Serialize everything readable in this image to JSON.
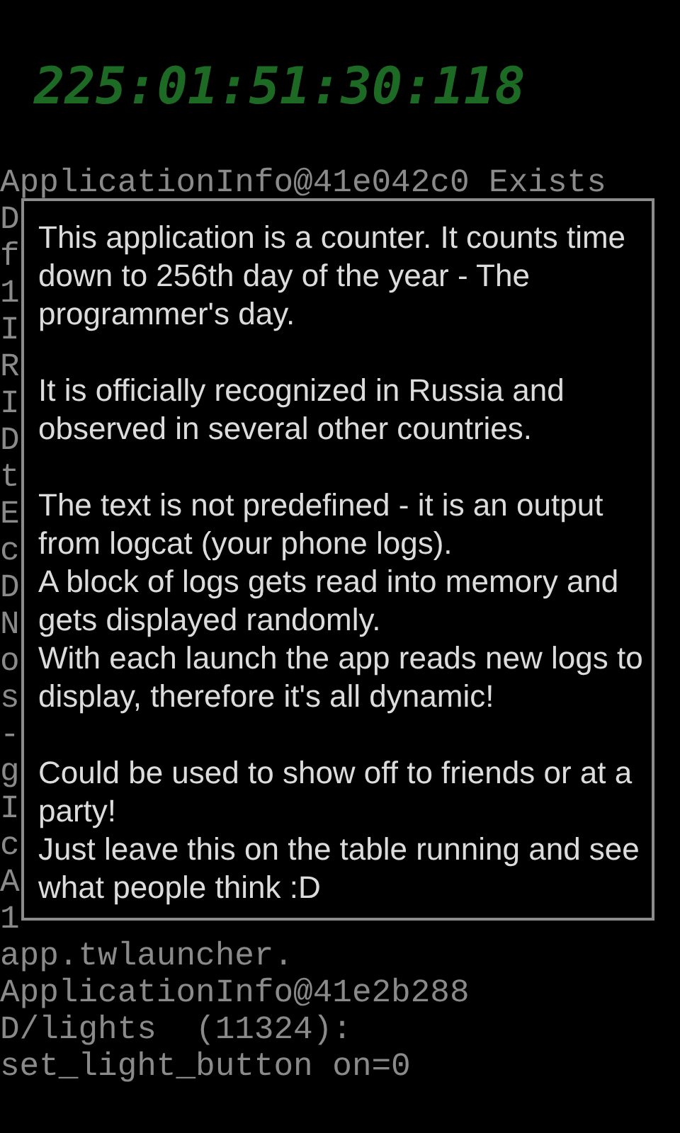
{
  "counter": "225:01:51:30:118",
  "log_lines": [
    "ApplicationInfo@41e042c0 Exists",
    "D",
    "f",
    "1",
    "I",
    "R",
    "I",
    "D",
    "t",
    "E",
    "c",
    "D",
    "N",
    "o",
    "s",
    "-",
    "g",
    "I",
    "c",
    "A",
    "1",
    "app.twlauncher.",
    "ApplicationInfo@41e2b288",
    "D/lights  (11324):",
    "set_light_button on=0"
  ],
  "dialog": {
    "sections": [
      {
        "paragraphs": [
          "This application is a counter. It counts time down to 256th day of the year - The programmer's day."
        ]
      },
      {
        "paragraphs": [
          "It is officially recognized in Russia and observed in several other countries."
        ]
      },
      {
        "paragraphs": [
          "The text is not predefined - it is an output from logcat (your phone logs).",
          "A block of logs gets read into memory and gets displayed randomly.",
          "With each launch the app reads new logs to display, therefore it's all dynamic!"
        ]
      },
      {
        "paragraphs": [
          "Could be used to show off to friends or at a party!",
          "Just leave this on the table running and see what people think :D"
        ]
      }
    ]
  }
}
